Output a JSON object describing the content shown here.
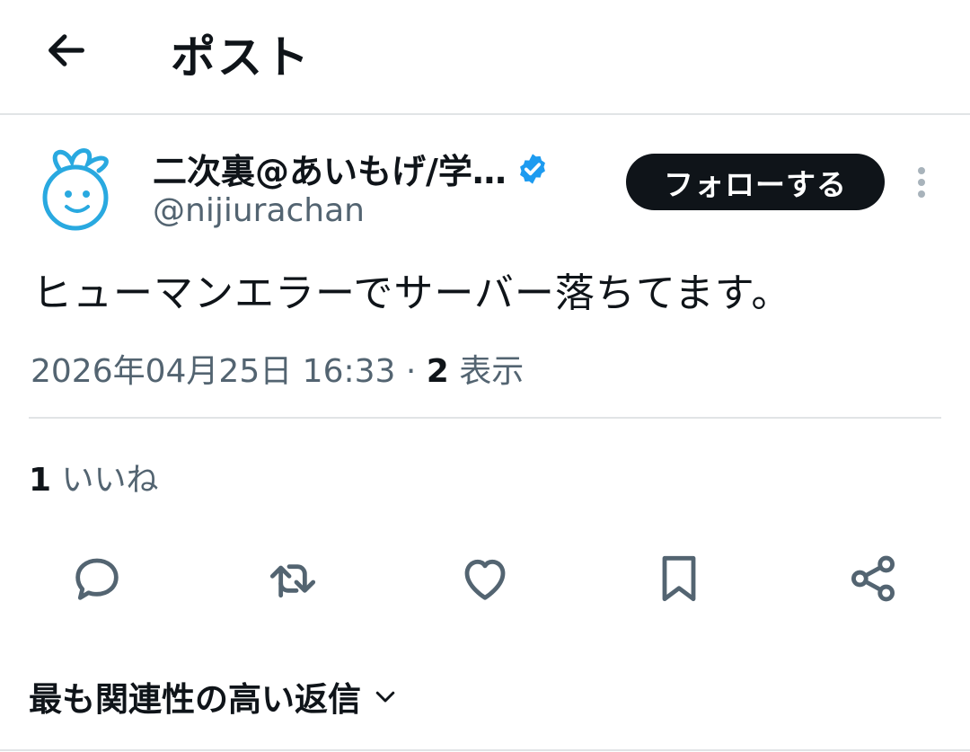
{
  "header": {
    "title": "ポスト",
    "back_icon": "arrow-left-icon"
  },
  "author": {
    "display_name": "二次裏@あいもげ/学…",
    "handle": "@nijiurachan",
    "verified_icon": "verified-badge-icon",
    "follow_label": "フォローする",
    "more_icon": "more-vertical-icon"
  },
  "tweet": {
    "text": "ヒューマンエラーでサーバー落ちてます。",
    "timestamp": "2026年04月25日 16:33",
    "separator": " · ",
    "views_count": "2",
    "views_label": "表示"
  },
  "stats": {
    "likes_count": "1",
    "likes_label": "いいね"
  },
  "actions": [
    "reply-icon",
    "retweet-icon",
    "like-icon",
    "bookmark-icon",
    "share-icon"
  ],
  "replies_sort": {
    "label": "最も関連性の高い返信",
    "icon": "chevron-down-icon"
  },
  "colors": {
    "text": "#0f1419",
    "secondary": "#536471",
    "verified": "#1d9bf0",
    "divider": "#e1e4e6",
    "avatar_blue": "#29a9e0"
  }
}
